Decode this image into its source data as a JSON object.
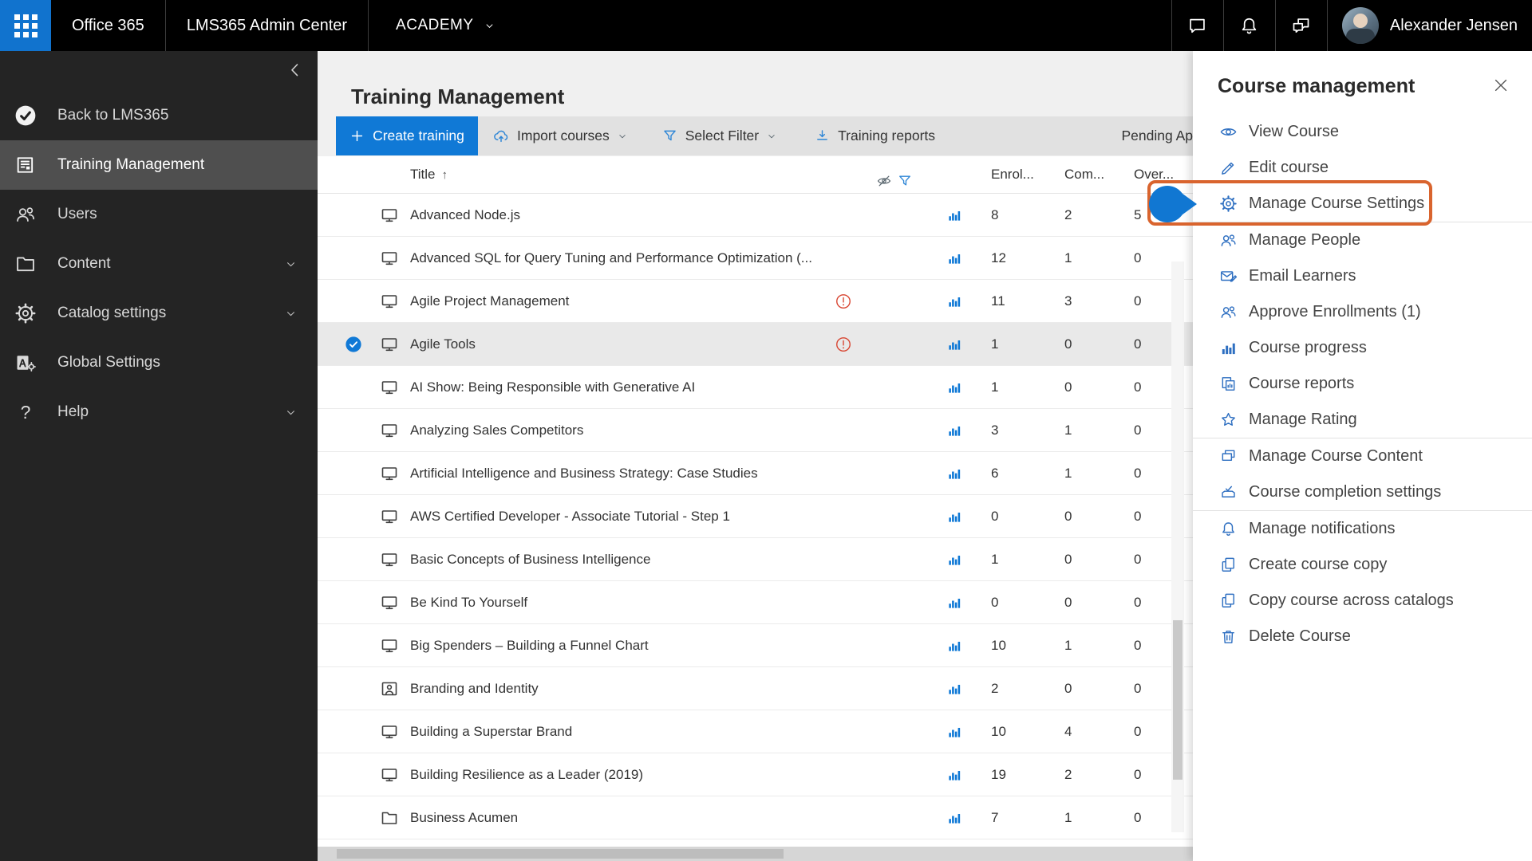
{
  "topbar": {
    "brand": "Office 365",
    "app_title": "LMS365 Admin Center",
    "tenant": "ACADEMY",
    "user_name": "Alexander Jensen",
    "action_icons": [
      "chat",
      "bell",
      "feedback"
    ]
  },
  "sidebar": {
    "items": [
      {
        "label": "Back to LMS365",
        "icon": "lms-logo",
        "selected": false,
        "expandable": false
      },
      {
        "label": "Training Management",
        "icon": "report",
        "selected": true,
        "expandable": false
      },
      {
        "label": "Users",
        "icon": "people",
        "selected": false,
        "expandable": false
      },
      {
        "label": "Content",
        "icon": "folder",
        "selected": false,
        "expandable": true
      },
      {
        "label": "Catalog settings",
        "icon": "gear",
        "selected": false,
        "expandable": true
      },
      {
        "label": "Global Settings",
        "icon": "global",
        "selected": false,
        "expandable": false
      },
      {
        "label": "Help",
        "icon": "help",
        "selected": false,
        "expandable": true
      }
    ]
  },
  "page": {
    "title": "Training Management",
    "toolbar": {
      "create_label": "Create training",
      "import_label": "Import courses",
      "filter_label": "Select Filter",
      "reports_label": "Training reports",
      "pending_label": "Pending Ap"
    },
    "table": {
      "columns": {
        "title": "Title",
        "enrolled": "Enrol...",
        "completed": "Com...",
        "overdue": "Over..."
      },
      "rows": [
        {
          "title": "Advanced Node.js",
          "icon": "monitor",
          "warning": false,
          "selected": false,
          "enrolled": "8",
          "completed": "2",
          "overdue": "5"
        },
        {
          "title": "Advanced SQL for Query Tuning and Performance Optimization (...",
          "icon": "monitor",
          "warning": false,
          "selected": false,
          "enrolled": "12",
          "completed": "1",
          "overdue": "0"
        },
        {
          "title": "Agile Project Management",
          "icon": "monitor",
          "warning": true,
          "selected": false,
          "enrolled": "11",
          "completed": "3",
          "overdue": "0"
        },
        {
          "title": "Agile Tools",
          "icon": "monitor",
          "warning": true,
          "selected": true,
          "enrolled": "1",
          "completed": "0",
          "overdue": "0"
        },
        {
          "title": "AI Show: Being Responsible with Generative AI",
          "icon": "monitor",
          "warning": false,
          "selected": false,
          "enrolled": "1",
          "completed": "0",
          "overdue": "0"
        },
        {
          "title": "Analyzing Sales Competitors",
          "icon": "monitor",
          "warning": false,
          "selected": false,
          "enrolled": "3",
          "completed": "1",
          "overdue": "0"
        },
        {
          "title": "Artificial Intelligence and Business Strategy: Case Studies",
          "icon": "monitor",
          "warning": false,
          "selected": false,
          "enrolled": "6",
          "completed": "1",
          "overdue": "0"
        },
        {
          "title": "AWS Certified Developer - Associate Tutorial - Step 1",
          "icon": "monitor",
          "warning": false,
          "selected": false,
          "enrolled": "0",
          "completed": "0",
          "overdue": "0"
        },
        {
          "title": "Basic Concepts of Business Intelligence",
          "icon": "monitor",
          "warning": false,
          "selected": false,
          "enrolled": "1",
          "completed": "0",
          "overdue": "0"
        },
        {
          "title": "Be Kind To Yourself",
          "icon": "monitor",
          "warning": false,
          "selected": false,
          "enrolled": "0",
          "completed": "0",
          "overdue": "0"
        },
        {
          "title": "Big Spenders – Building a Funnel Chart",
          "icon": "monitor",
          "warning": false,
          "selected": false,
          "enrolled": "10",
          "completed": "1",
          "overdue": "0"
        },
        {
          "title": "Branding and Identity",
          "icon": "person-frame",
          "warning": false,
          "selected": false,
          "enrolled": "2",
          "completed": "0",
          "overdue": "0"
        },
        {
          "title": "Building a Superstar Brand",
          "icon": "monitor",
          "warning": false,
          "selected": false,
          "enrolled": "10",
          "completed": "4",
          "overdue": "0"
        },
        {
          "title": "Building Resilience as a Leader (2019)",
          "icon": "monitor",
          "warning": false,
          "selected": false,
          "enrolled": "19",
          "completed": "2",
          "overdue": "0"
        },
        {
          "title": "Business Acumen",
          "icon": "folder",
          "warning": false,
          "selected": false,
          "enrolled": "7",
          "completed": "1",
          "overdue": "0"
        }
      ]
    }
  },
  "panel": {
    "title": "Course management",
    "items": [
      {
        "label": "View Course",
        "icon": "eye",
        "highlighted": false,
        "divider_before": false
      },
      {
        "label": "Edit course",
        "icon": "pencil",
        "highlighted": false,
        "divider_before": false
      },
      {
        "label": "Manage Course Settings",
        "icon": "gear",
        "highlighted": true,
        "divider_before": false
      },
      {
        "label": "Manage People",
        "icon": "people",
        "highlighted": false,
        "divider_before": true
      },
      {
        "label": "Email Learners",
        "icon": "mail",
        "highlighted": false,
        "divider_before": false
      },
      {
        "label": "Approve Enrollments (1)",
        "icon": "people",
        "highlighted": false,
        "divider_before": false
      },
      {
        "label": "Course progress",
        "icon": "chart-bars",
        "highlighted": false,
        "divider_before": false
      },
      {
        "label": "Course reports",
        "icon": "report-pages",
        "highlighted": false,
        "divider_before": false
      },
      {
        "label": "Manage Rating",
        "icon": "star",
        "highlighted": false,
        "divider_before": false
      },
      {
        "label": "Manage Course Content",
        "icon": "layers",
        "highlighted": false,
        "divider_before": true
      },
      {
        "label": "Course completion settings",
        "icon": "tray-check",
        "highlighted": false,
        "divider_before": false
      },
      {
        "label": "Manage notifications",
        "icon": "bell",
        "highlighted": false,
        "divider_before": true
      },
      {
        "label": "Create course copy",
        "icon": "copy",
        "highlighted": false,
        "divider_before": false
      },
      {
        "label": "Copy course across catalogs",
        "icon": "copy",
        "highlighted": false,
        "divider_before": false
      },
      {
        "label": "Delete Course",
        "icon": "trash",
        "highlighted": false,
        "divider_before": false
      }
    ]
  },
  "colors": {
    "accent_blue": "#1173ce",
    "button_blue": "#1079d6",
    "icon_blue": "#2e6fc1",
    "warning_red": "#d8432f",
    "annotation_orange": "#d9642e",
    "topbar_bg": "#000000",
    "sidebar_bg": "#242424"
  }
}
